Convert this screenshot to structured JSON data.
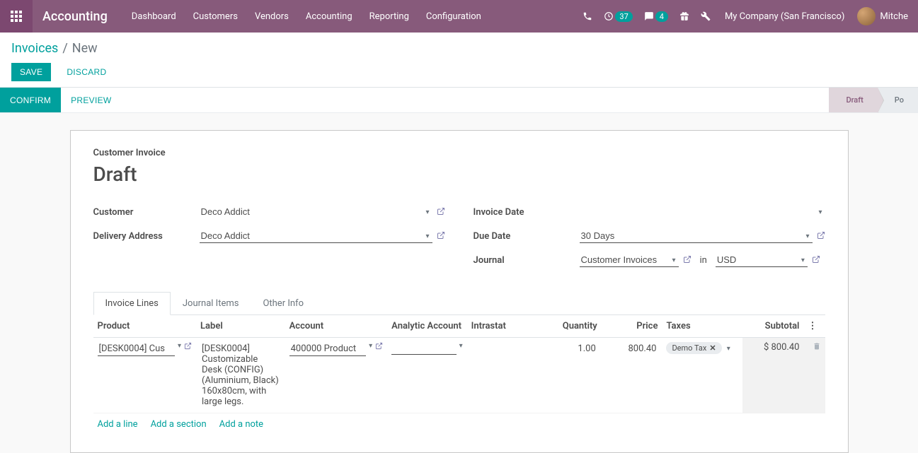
{
  "navbar": {
    "app_title": "Accounting",
    "menu": [
      "Dashboard",
      "Customers",
      "Vendors",
      "Accounting",
      "Reporting",
      "Configuration"
    ],
    "activities_count": "37",
    "messages_count": "4",
    "company": "My Company (San Francisco)",
    "user": "Mitche"
  },
  "breadcrumb": {
    "parent": "Invoices",
    "current": "New"
  },
  "buttons": {
    "save": "Save",
    "discard": "Discard",
    "confirm": "Confirm",
    "preview": "Preview"
  },
  "status": {
    "draft": "Draft",
    "posted": "Po"
  },
  "sheet": {
    "subtitle": "Customer Invoice",
    "title": "Draft",
    "labels": {
      "customer": "Customer",
      "delivery_address": "Delivery Address",
      "invoice_date": "Invoice Date",
      "due_date": "Due Date",
      "journal": "Journal",
      "in": "in"
    },
    "fields": {
      "customer": "Deco Addict",
      "delivery_address": "Deco Addict",
      "invoice_date": "",
      "due_date": "30 Days",
      "journal": "Customer Invoices",
      "currency": "USD"
    }
  },
  "tabs": {
    "invoice_lines": "Invoice Lines",
    "journal_items": "Journal Items",
    "other_info": "Other Info"
  },
  "table": {
    "headers": {
      "product": "Product",
      "label": "Label",
      "account": "Account",
      "analytic": "Analytic Account",
      "intrastat": "Intrastat",
      "quantity": "Quantity",
      "price": "Price",
      "taxes": "Taxes",
      "subtotal": "Subtotal"
    },
    "rows": [
      {
        "product": "[DESK0004] Cus",
        "label": "[DESK0004] Customizable Desk (CONFIG) (Aluminium, Black) 160x80cm, with large legs.",
        "account": "400000 Product",
        "analytic": "",
        "intrastat": "",
        "quantity": "1.00",
        "price": "800.40",
        "tax": "Demo Tax",
        "subtotal": "$ 800.40"
      }
    ],
    "add_line": "Add a line",
    "add_section": "Add a section",
    "add_note": "Add a note"
  }
}
